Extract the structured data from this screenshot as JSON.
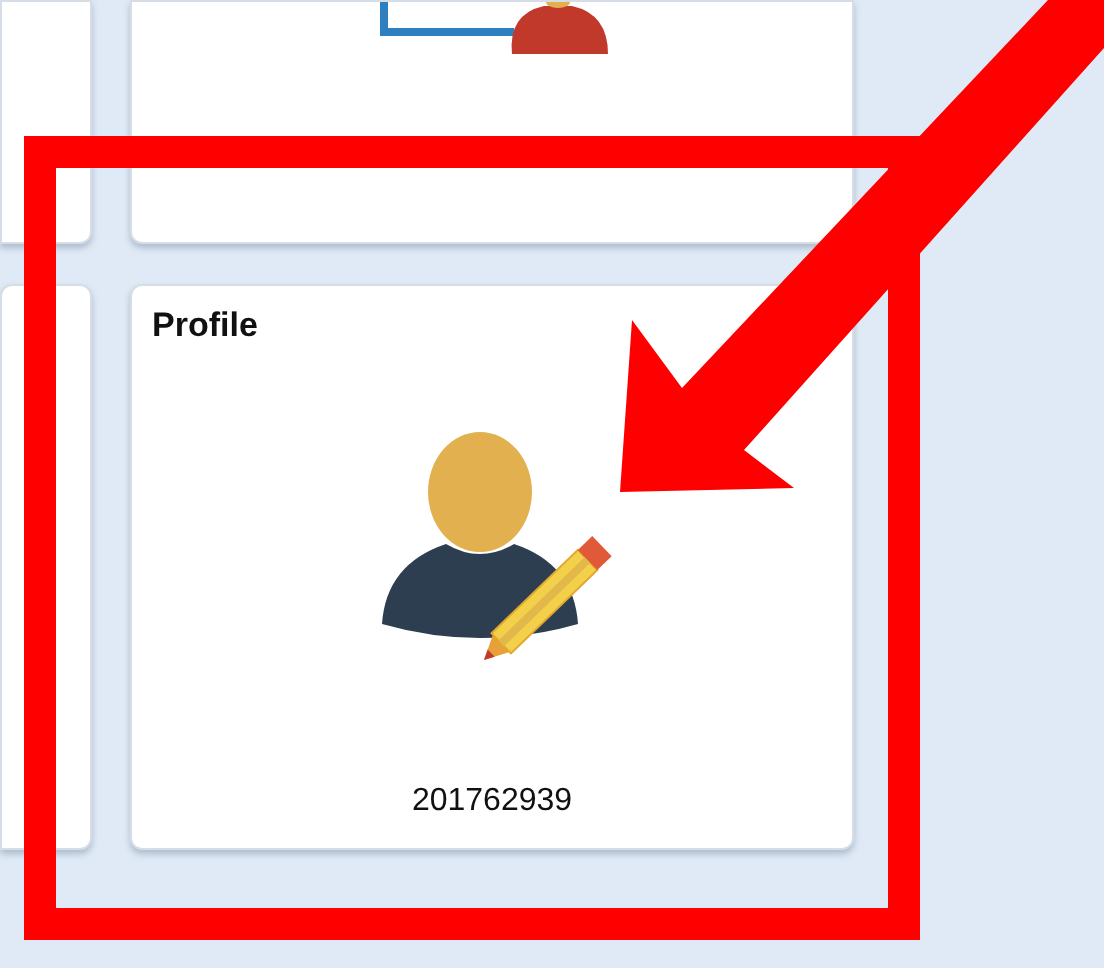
{
  "tiles": [
    {
      "kind": "blank"
    },
    {
      "kind": "partial-icon"
    },
    {
      "kind": "blank"
    },
    {
      "kind": "profile",
      "title": "Profile",
      "caption": "201762939"
    }
  ],
  "annotation": {
    "kind": "box-arrow"
  }
}
